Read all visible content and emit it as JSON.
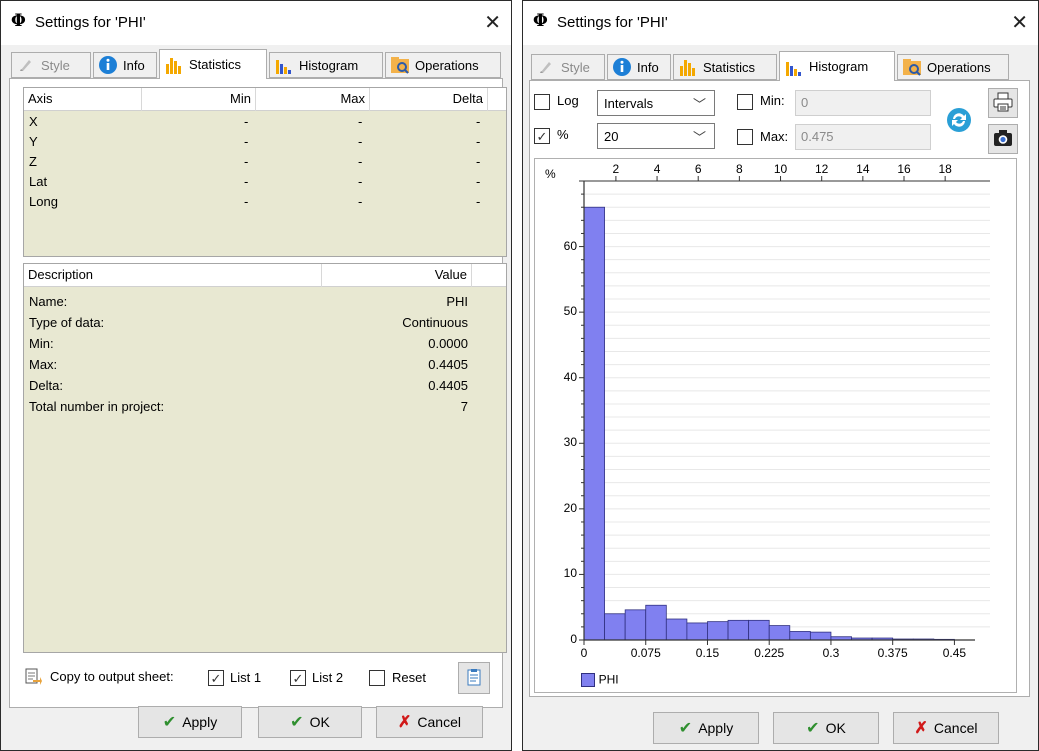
{
  "title_symbol": "Φ",
  "window_title": "Settings for 'PHI'",
  "tabs": [
    {
      "label": "Style",
      "state": "disabled"
    },
    {
      "label": "Info",
      "state": "normal"
    },
    {
      "label": "Statistics",
      "state": "normal"
    },
    {
      "label": "Histogram",
      "state": "normal"
    },
    {
      "label": "Operations",
      "state": "normal"
    }
  ],
  "statistics": {
    "axis_table": {
      "columns": [
        "Axis",
        "Min",
        "Max",
        "Delta"
      ],
      "rows": [
        [
          "X",
          "-",
          "-",
          "-"
        ],
        [
          "Y",
          "-",
          "-",
          "-"
        ],
        [
          "Z",
          "-",
          "-",
          "-"
        ],
        [
          "Lat",
          "-",
          "-",
          "-"
        ],
        [
          "Long",
          "-",
          "-",
          "-"
        ]
      ]
    },
    "desc_table": {
      "columns": [
        "Description",
        "Value"
      ],
      "rows": [
        [
          "Name:",
          "PHI"
        ],
        [
          "Type of data:",
          "Continuous"
        ],
        [
          "Min:",
          "0.0000"
        ],
        [
          "Max:",
          "0.4405"
        ],
        [
          "Delta:",
          "0.4405"
        ],
        [
          "Total number in project:",
          "7"
        ]
      ]
    },
    "copy_label": "Copy to output sheet:",
    "list1": {
      "label": "List 1",
      "checked": true
    },
    "list2": {
      "label": "List 2",
      "checked": true
    },
    "reset": {
      "label": "Reset",
      "checked": false
    }
  },
  "histogram": {
    "log": {
      "label": "Log",
      "checked": false
    },
    "percent": {
      "label": "%",
      "checked": true
    },
    "mode_select": "Intervals",
    "count_select": "20",
    "min": {
      "label": "Min:",
      "value": "0",
      "checked": false
    },
    "max": {
      "label": "Max:",
      "value": "0.475",
      "checked": false
    }
  },
  "buttons": {
    "apply": "Apply",
    "ok": "OK",
    "cancel": "Cancel"
  },
  "colors": {
    "bar_fill": "#8080f0",
    "bar_stroke": "#303080",
    "grid_bg": "#e8e8d2",
    "apply_check": "#2f8f2f",
    "cancel_x": "#d11a1a"
  },
  "chart_data": {
    "type": "bar",
    "ylabel": "%",
    "bin_count": 20,
    "bin_width": 0.025,
    "x_range": [
      0,
      0.475
    ],
    "xticks": [
      "0",
      "0.075",
      "0.15",
      "0.225",
      "0.3",
      "0.375",
      "0.45"
    ],
    "xtick_values": [
      0,
      0.075,
      0.15,
      0.225,
      0.3,
      0.375,
      0.45
    ],
    "top_ticks": [
      "2",
      "4",
      "6",
      "8",
      "10",
      "12",
      "14",
      "16",
      "18"
    ],
    "yticks": [
      "0",
      "10",
      "20",
      "30",
      "40",
      "50",
      "60"
    ],
    "ylim": [
      0,
      70
    ],
    "series": [
      {
        "name": "PHI",
        "values": [
          66,
          4,
          4.6,
          5.3,
          3.2,
          2.6,
          2.8,
          3,
          3,
          2.2,
          1.3,
          1.2,
          0.5,
          0.3,
          0.3,
          0.15,
          0.15,
          0.1,
          0,
          0
        ]
      }
    ],
    "legend": "bottom-left"
  }
}
